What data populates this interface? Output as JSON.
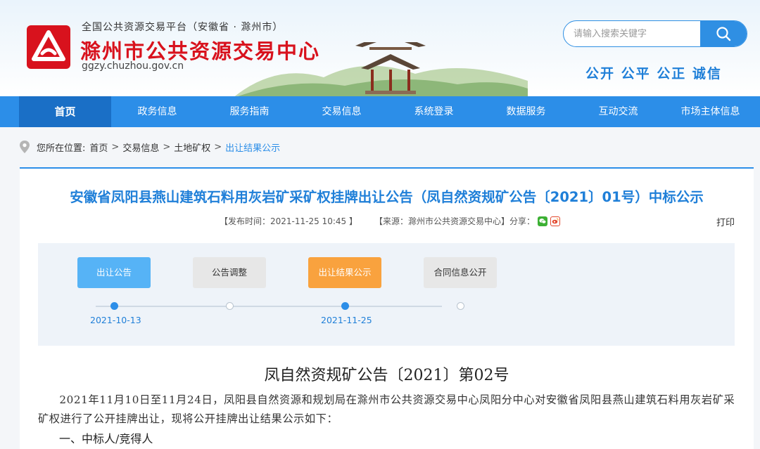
{
  "header": {
    "platform_line": "全国公共资源交易平台（安徽省 · 滁州市）",
    "site_name": "滁州市公共资源交易中心",
    "domain": "ggzy.chuzhou.gov.cn",
    "search": {
      "placeholder": "请输入搜索关键字"
    },
    "slogan": "公开 公平 公正 诚信",
    "brand_color": "#d8121d"
  },
  "nav": {
    "items": [
      {
        "label": "首页",
        "active": true
      },
      {
        "label": "政务信息"
      },
      {
        "label": "服务指南"
      },
      {
        "label": "交易信息"
      },
      {
        "label": "系统登录"
      },
      {
        "label": "数据服务"
      },
      {
        "label": "互动交流"
      },
      {
        "label": "市场主体信息"
      }
    ],
    "color": "#2c8ee8"
  },
  "breadcrumb": {
    "prefix": "您所在位置:",
    "items": [
      "首页",
      "交易信息",
      "土地矿权",
      "出让结果公示"
    ],
    "separator": ">"
  },
  "article": {
    "title": "安徽省凤阳县燕山建筑石料用灰岩矿采矿权挂牌出让公告（凤自然资规矿公告〔2021〕01号）中标公示",
    "publish_time": "【发布时间：2021-11-25 10:45 】",
    "source": "【来源：滁州市公共资源交易中心】",
    "share_label": "分享：",
    "print_label": "打印"
  },
  "timeline": {
    "buttons": [
      {
        "label": "出让公告",
        "state": "done"
      },
      {
        "label": "公告调整",
        "state": "inactive"
      },
      {
        "label": "出让结果公示",
        "state": "current"
      },
      {
        "label": "合同信息公开",
        "state": "inactive"
      }
    ],
    "dates": [
      "2021-10-13",
      "2021-11-25"
    ]
  },
  "document": {
    "title": "凤自然资规矿公告〔2021〕第02号",
    "paragraph": "2021年11月10日至11月24日，凤阳县自然资源和规划局在滁州市公共资源交易中心凤阳分中心对安徽省凤阳县燕山建筑石料用灰岩矿采矿权进行了公开挂牌出让，现将公开挂牌出让结果公示如下：",
    "section1": "一、中标人/竞得人"
  }
}
